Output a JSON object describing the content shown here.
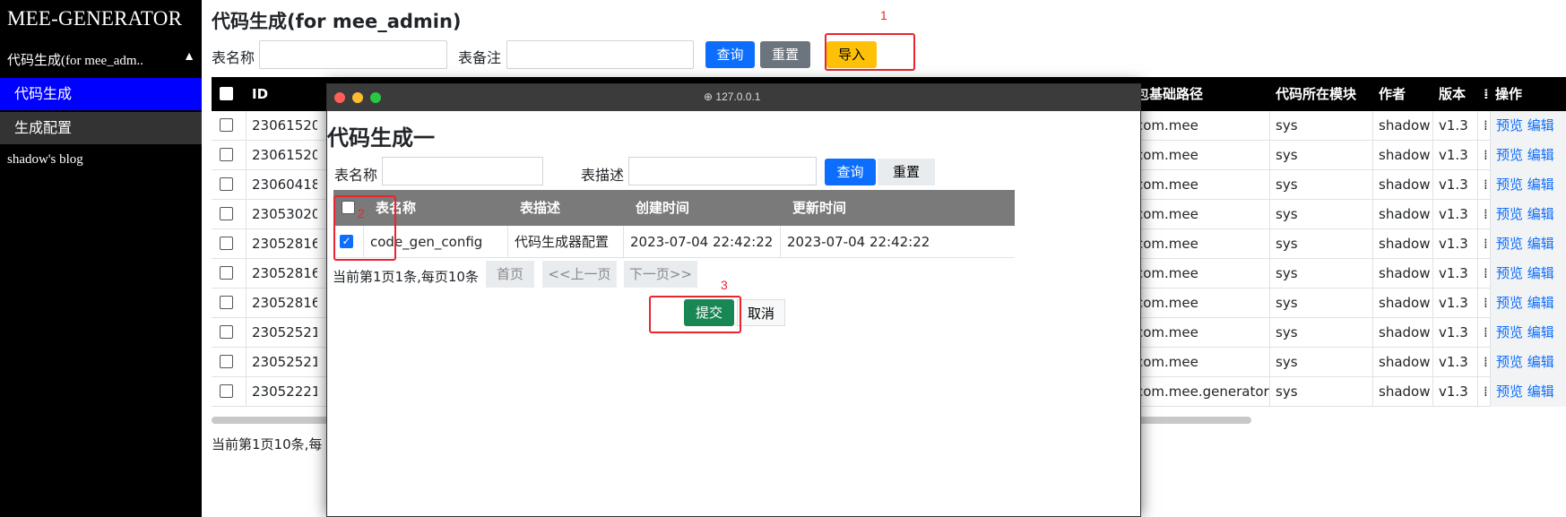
{
  "sidebar": {
    "brand": "MEE-GENERATOR",
    "group_label": "代码生成(for mee_adm..",
    "group_caret": "▲",
    "items": [
      {
        "label": "代码生成"
      },
      {
        "label": "生成配置"
      }
    ],
    "blog_link": "shadow's blog"
  },
  "header": {
    "title": "代码生成(for mee_admin)"
  },
  "search": {
    "table_name_label": "表名称",
    "table_comment_label": "表备注",
    "query_btn": "查询",
    "reset_btn": "重置",
    "import_btn": "导入"
  },
  "table": {
    "columns": [
      "ID",
      "包基础路径",
      "代码所在模块",
      "作者",
      "版本",
      "操作"
    ],
    "rows": [
      {
        "id": "230615205",
        "pkg": "com.mee",
        "module": "sys",
        "author": "shadow",
        "version": "v1.3"
      },
      {
        "id": "230615204",
        "pkg": "com.mee",
        "module": "sys",
        "author": "shadow",
        "version": "v1.3"
      },
      {
        "id": "230604184",
        "pkg": "com.mee",
        "module": "sys",
        "author": "shadow",
        "version": "v1.3"
      },
      {
        "id": "230530205",
        "pkg": "com.mee",
        "module": "sys",
        "author": "shadow",
        "version": "v1.3"
      },
      {
        "id": "230528164",
        "pkg": "com.mee",
        "module": "sys",
        "author": "shadow",
        "version": "v1.3"
      },
      {
        "id": "230528164",
        "pkg": "com.mee",
        "module": "sys",
        "author": "shadow",
        "version": "v1.3"
      },
      {
        "id": "230528164",
        "pkg": "com.mee",
        "module": "sys",
        "author": "shadow",
        "version": "v1.3"
      },
      {
        "id": "230525215",
        "pkg": "com.mee",
        "module": "sys",
        "author": "shadow",
        "version": "v1.3"
      },
      {
        "id": "230525215",
        "pkg": "com.mee",
        "module": "sys",
        "author": "shadow",
        "version": "v1.3"
      },
      {
        "id": "230522215",
        "pkg": "com.mee.generator",
        "module": "sys",
        "author": "shadow",
        "version": "v1.3"
      }
    ],
    "row_action_preview": "预览",
    "row_action_edit": "编辑",
    "pager_text": "当前第1页10条,每"
  },
  "modal": {
    "url": "127.0.0.1",
    "title": "代码生成一",
    "table_name_label": "表名称",
    "table_desc_label": "表描述",
    "query_btn": "查询",
    "reset_btn": "重置",
    "columns": [
      "表名称",
      "表描述",
      "创建时间",
      "更新时间"
    ],
    "rows": [
      {
        "name": "code_gen_config",
        "desc": "代码生成器配置",
        "created": "2023-07-04 22:42:22",
        "updated": "2023-07-04 22:42:22",
        "checked": true
      }
    ],
    "pager_text": "当前第1页1条,每页10条",
    "first_page": "首页",
    "prev_page": "<<上一页",
    "next_page": "下一页>>",
    "submit_btn": "提交",
    "cancel_btn": "取消"
  },
  "annotations": [
    "1",
    "2",
    "3"
  ],
  "colors": {
    "accent": "#0d6efd",
    "sidebar_active": "#0000ff",
    "annotation": "#e8262e",
    "import_btn": "#ffc107",
    "submit_btn": "#198754"
  }
}
